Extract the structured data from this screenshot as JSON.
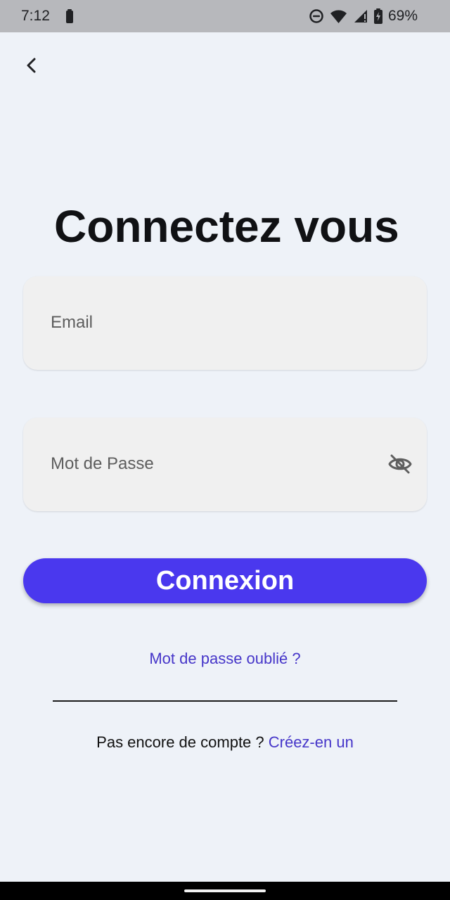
{
  "status_bar": {
    "time": "7:12",
    "battery_percent": "69%",
    "left_icon": "battery-icon",
    "right_icons": [
      "do-not-disturb-icon",
      "wifi-icon",
      "signal-icon",
      "battery-icon"
    ]
  },
  "screen": {
    "back_icon": "chevron-left-icon",
    "title": "Connectez vous",
    "email_placeholder": "Email",
    "password_placeholder": "Mot de Passe",
    "visibility_icon": "eye-off-icon",
    "login_label": "Connexion",
    "forgot_password_label": "Mot de passe oublié ?",
    "signup_prompt": "Pas encore de compte ? ",
    "signup_link_label": "Créez-en un"
  },
  "colors": {
    "background": "#eef2f8",
    "status_bar": "#b7b8bc",
    "field_background": "#f0f0f0",
    "primary_button": "#4a38ee",
    "link": "#4636c9",
    "title_text": "#101114"
  },
  "navigation": {
    "home_indicator": "home-indicator"
  }
}
